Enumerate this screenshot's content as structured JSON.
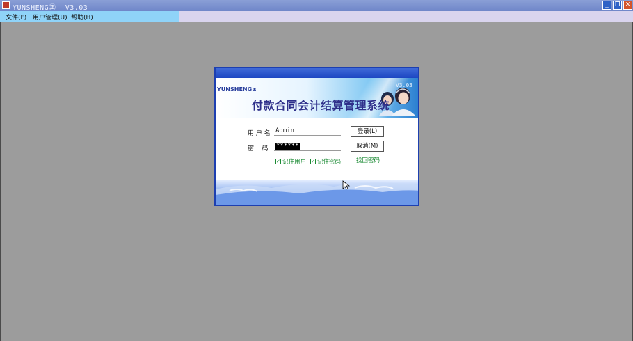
{
  "window": {
    "title": "YUNSHENG㊣  V3.03",
    "buttons": {
      "minimize": "_",
      "restore": "❐",
      "close": "✕"
    }
  },
  "menu": {
    "items": [
      {
        "label": "文件(F)"
      },
      {
        "label": "用户管理(U)"
      },
      {
        "label": "帮助(H)"
      }
    ]
  },
  "dialog": {
    "brand": "YUNSHENG±",
    "version": "V3.03",
    "system_title": "付款合同会计结算管理系统",
    "username_label": "用 户 名",
    "username_value": "Admin",
    "password_label": "密    码",
    "password_value": "******",
    "login_button": "登录(L)",
    "cancel_button": "取消(M)",
    "remember_user": "记住用户",
    "remember_password": "记住密码",
    "find_password": "找回密码"
  },
  "colors": {
    "desktop": "#9c9c9c",
    "titlebar": "#7a90d0",
    "menubar_area": "#8fd3f8",
    "accent_green": "#1a8a33",
    "dialog_border": "#1d3fb0"
  }
}
